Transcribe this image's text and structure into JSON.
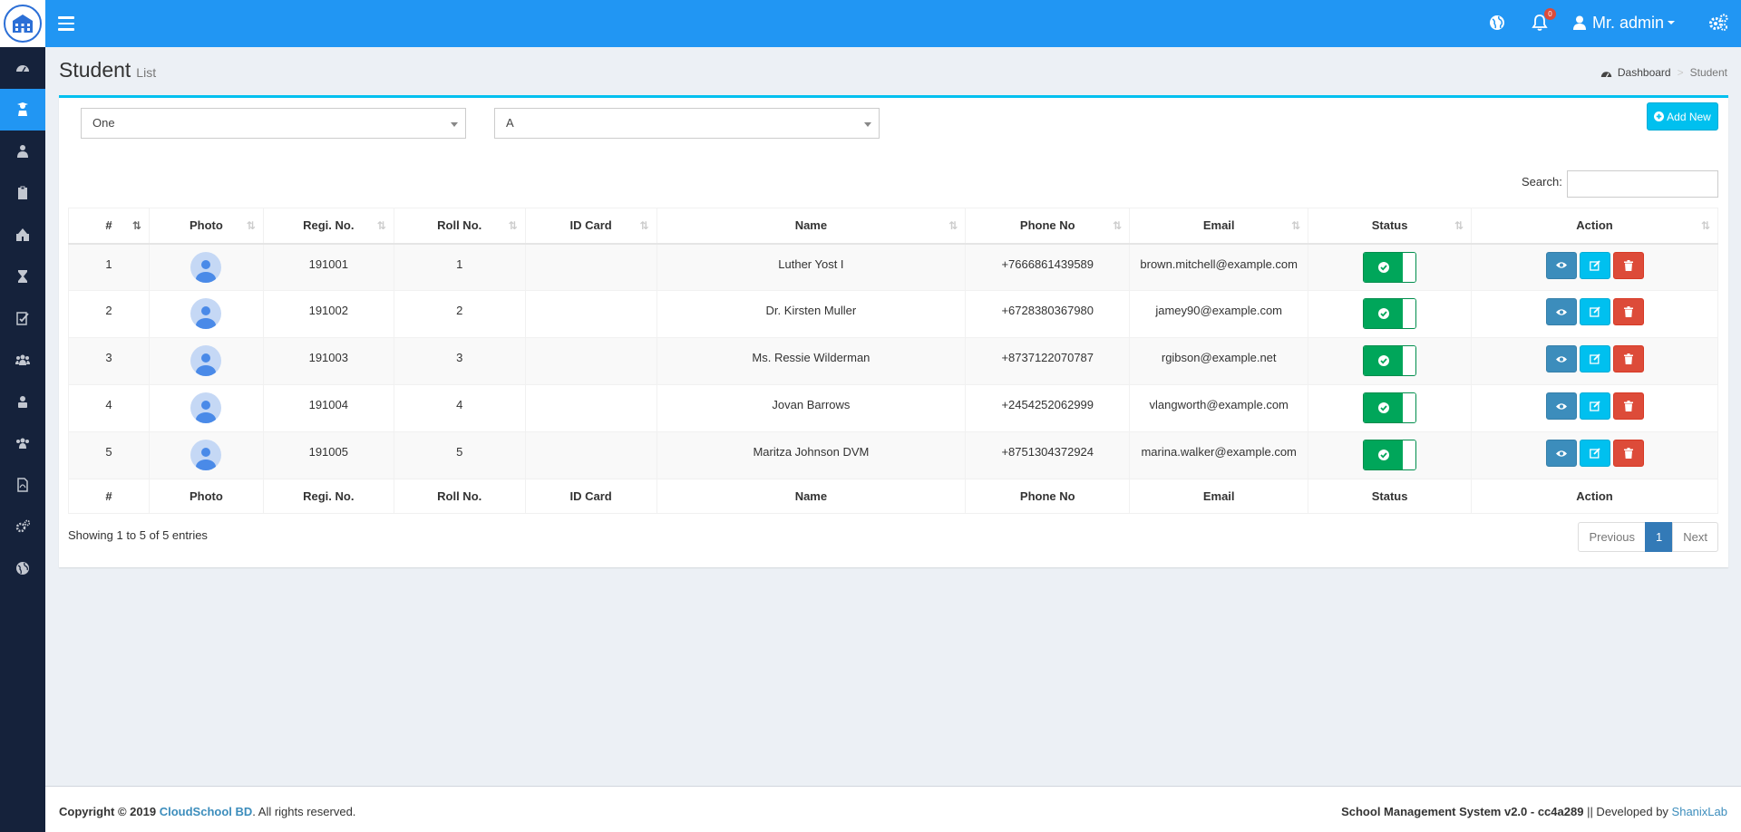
{
  "header": {
    "user_name": "Mr. admin",
    "notification_count": "0"
  },
  "page": {
    "title": "Student",
    "subtitle": "List",
    "breadcrumb": [
      "Dashboard",
      "Student"
    ]
  },
  "filters": {
    "class_value": "One",
    "section_value": "A"
  },
  "actions": {
    "add_new": "Add New"
  },
  "search": {
    "label": "Search:",
    "value": ""
  },
  "table": {
    "columns": [
      "#",
      "Photo",
      "Regi. No.",
      "Roll No.",
      "ID Card",
      "Name",
      "Phone No",
      "Email",
      "Status",
      "Action"
    ],
    "rows": [
      {
        "num": "1",
        "regi": "191001",
        "roll": "1",
        "id_card": "",
        "name": "Luther Yost I",
        "phone": "+7666861439589",
        "email": "brown.mitchell@example.com"
      },
      {
        "num": "2",
        "regi": "191002",
        "roll": "2",
        "id_card": "",
        "name": "Dr. Kirsten Muller",
        "phone": "+6728380367980",
        "email": "jamey90@example.com"
      },
      {
        "num": "3",
        "regi": "191003",
        "roll": "3",
        "id_card": "",
        "name": "Ms. Ressie Wilderman",
        "phone": "+8737122070787",
        "email": "rgibson@example.net"
      },
      {
        "num": "4",
        "regi": "191004",
        "roll": "4",
        "id_card": "",
        "name": "Jovan Barrows",
        "phone": "+2454252062999",
        "email": "vlangworth@example.com"
      },
      {
        "num": "5",
        "regi": "191005",
        "roll": "5",
        "id_card": "",
        "name": "Maritza Johnson DVM",
        "phone": "+8751304372924",
        "email": "marina.walker@example.com"
      }
    ]
  },
  "pagination": {
    "info": "Showing 1 to 5 of 5 entries",
    "previous": "Previous",
    "current": "1",
    "next": "Next"
  },
  "footer": {
    "copyright_prefix": "Copyright © 2019 ",
    "company": "CloudSchool BD",
    "copyright_suffix": ". All rights reserved.",
    "app_version": "School Management System v2.0 - cc4a289",
    "developed_prefix": " || Developed by ",
    "developer": "ShanixLab"
  },
  "colors": {
    "topbar": "#2196f3",
    "sidebar": "#15223b",
    "status_on": "#00a65a",
    "view_btn": "#3c8dbc",
    "edit_btn": "#00c0ef",
    "delete_btn": "#dd4b39"
  },
  "sidebar_icons": [
    "dashboard-icon",
    "student-icon",
    "teacher-icon",
    "clipboard-icon",
    "school-icon",
    "hourglass-icon",
    "exam-icon",
    "users-icon",
    "staff-icon",
    "group-icon",
    "report-icon",
    "settings-icon",
    "globe-icon"
  ]
}
